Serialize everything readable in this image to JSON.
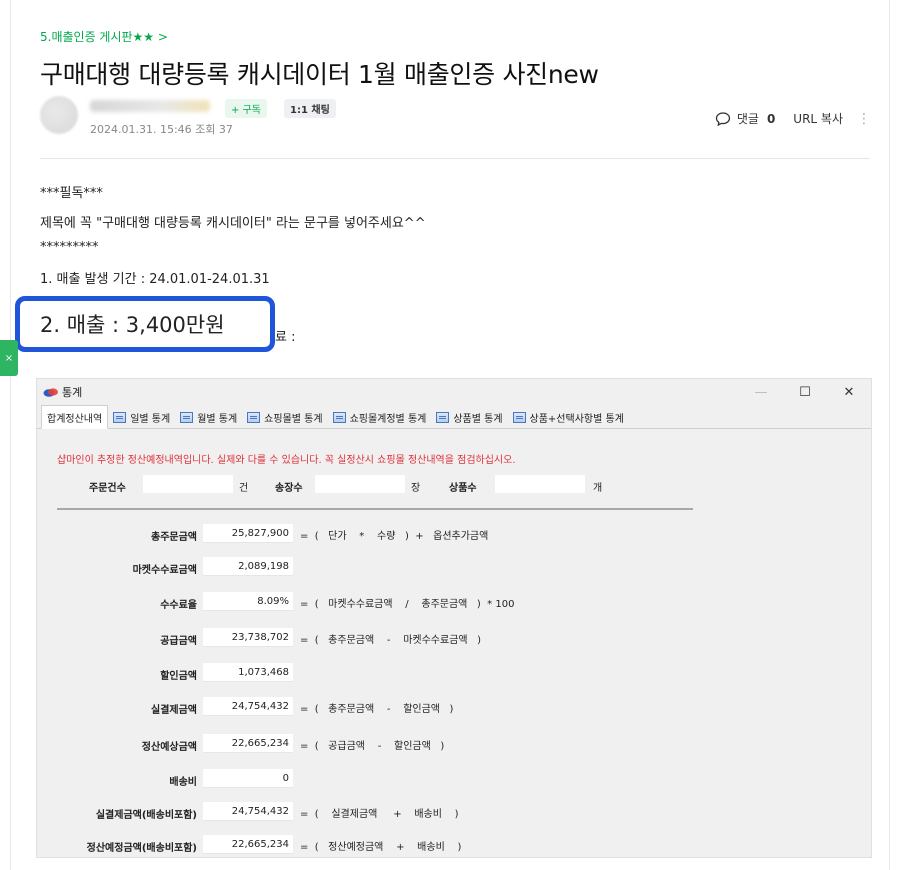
{
  "post": {
    "board_link": "5.매출인증 게시판★★ >",
    "title": "구매대행 대량등록 캐시데이터 1월 매출인증 사진new",
    "subscribe": "+ 구독",
    "chat": "1:1 채팅",
    "date_views": "2024.01.31. 15:46  조회 37",
    "comment_label": "댓글",
    "comment_count": "0",
    "url_copy": "URL 복사",
    "more": "⋮"
  },
  "content": {
    "line1": "***필독***",
    "line2": "제목에 꼭 \"구매대행 대량등록 캐시데이터\" 라는 문구를 넣어주세요^^",
    "line3": "*********",
    "line4": "1. 매출 발생 기간 : 24.01.01-24.01.31",
    "highlight": "2. 매출 : 3,400만원",
    "hidden_tail": "료 :"
  },
  "window": {
    "title": "통계",
    "controls": {
      "minimize": "—",
      "maximize": "☐",
      "close": "✕"
    },
    "tabs": [
      {
        "label": "합계정산내역",
        "active": true
      },
      {
        "label": "일별 통계"
      },
      {
        "label": "월별 통계"
      },
      {
        "label": "쇼핑몰별 통계"
      },
      {
        "label": "쇼핑몰계정별 통계"
      },
      {
        "label": "상품별 통계"
      },
      {
        "label": "상품+선택사항별 통계"
      }
    ],
    "notice": "샵마인이 추정한 정산예정내역입니다. 실제와 다를 수 있습니다. 꼭 실정산시 쇼핑몰 정산내역을 점검하십시오.",
    "counts": {
      "orders_label": "주문건수",
      "orders_unit": "건",
      "invoices_label": "송장수",
      "invoices_unit": "장",
      "products_label": "상품수",
      "products_unit": "개"
    },
    "rows": [
      {
        "label": "총주문금액",
        "value": "25,827,900",
        "formula": "=  (   단가    *    수량   )  +   옵션추가금액"
      },
      {
        "label": "마켓수수료금액",
        "value": "2,089,198",
        "formula": ""
      },
      {
        "label": "수수료율",
        "value": "8.09%",
        "formula": "=  (   마켓수수료금액    /    총주문금액   )  * 100"
      },
      {
        "label": "공급금액",
        "value": "23,738,702",
        "formula": "=  (   총주문금액    -    마켓수수료금액   )"
      },
      {
        "label": "할인금액",
        "value": "1,073,468",
        "formula": ""
      },
      {
        "label": "실결제금액",
        "value": "24,754,432",
        "formula": "=  (   총주문금액    -    할인금액   )"
      },
      {
        "label": "정산예상금액",
        "value": "22,665,234",
        "formula": "=  (   공급금액    -    할인금액   )"
      },
      {
        "label": "배송비",
        "value": "0",
        "formula": ""
      },
      {
        "label": "실결제금액(배송비포함)",
        "value": "24,754,432",
        "formula": "=  (    실결제금액     +    배송비    )"
      },
      {
        "label": "정산예정금액(배송비포함)",
        "value": "22,665,234",
        "formula": "=  (   정산예정금액    +    배송비    )"
      }
    ]
  }
}
